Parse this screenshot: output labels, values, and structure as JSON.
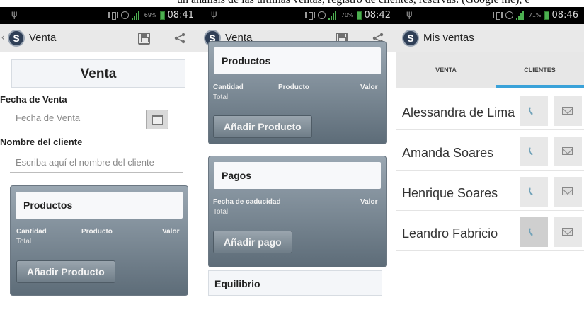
{
  "caption": "un análisis de las últimas ventas, registro de clientes, reservas. (Google me), e",
  "screens": [
    {
      "status": {
        "battery_pct": "69%",
        "time": "08:41"
      },
      "app_title": "Venta",
      "page_heading": "Venta",
      "fecha_label": "Fecha de Venta",
      "fecha_placeholder": "Fecha de Venta",
      "cliente_label": "Nombre del cliente",
      "cliente_placeholder": "Escriba aquí el nombre del cliente",
      "productos": {
        "heading": "Productos",
        "col_cantidad": "Cantidad",
        "col_producto": "Producto",
        "col_valor": "Valor",
        "total": "Total",
        "button": "Añadir Producto"
      }
    },
    {
      "status": {
        "battery_pct": "70%",
        "time": "08:42"
      },
      "app_title": "Venta",
      "productos": {
        "heading": "Productos",
        "col_cantidad": "Cantidad",
        "col_producto": "Producto",
        "col_valor": "Valor",
        "total": "Total",
        "button": "Añadir Producto"
      },
      "pagos": {
        "heading": "Pagos",
        "col_fecha": "Fecha de caducidad",
        "col_valor": "Valor",
        "total": "Total",
        "button": "Añadir pago"
      },
      "equilibrio": "Equilibrio"
    },
    {
      "status": {
        "battery_pct": "71%",
        "time": "08:46"
      },
      "app_title": "Mis ventas",
      "tabs": [
        "VENTA",
        "CLIENTES"
      ],
      "active_tab": "CLIENTES",
      "clients": [
        "Alessandra de Lima",
        "Amanda Soares",
        "Henrique Soares",
        "Leandro Fabricio"
      ]
    }
  ],
  "icons": {
    "logo": "app-logo-s-icon",
    "save": "save-icon",
    "share": "share-icon",
    "calendar": "calendar-icon",
    "phone": "phone-icon",
    "mail": "mail-icon"
  },
  "colors": {
    "statusbar": "#000000",
    "actionbar": "#e9e9e9",
    "card_gradient_top": "#9aa7b2",
    "card_gradient_bottom": "#5d6c78",
    "tab_underline": "#3aa2d9",
    "phone_icon": "#6fa1b8"
  }
}
